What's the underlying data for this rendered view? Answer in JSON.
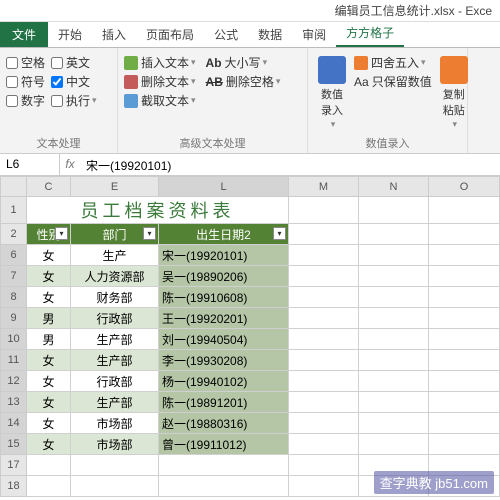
{
  "window": {
    "title": "编辑员工信息统计.xlsx - Exce"
  },
  "tabs": {
    "file": "文件",
    "items": [
      "开始",
      "插入",
      "页面布局",
      "公式",
      "数据",
      "审阅",
      "方方格子"
    ],
    "active": 6
  },
  "ribbon": {
    "g1": {
      "label": "文本处理",
      "chk_space": "空格",
      "chk_en": "英文",
      "chk_sym": "符号",
      "chk_cn": "中文",
      "chk_num": "数字",
      "chk_exec": "执行"
    },
    "g2": {
      "label": "高级文本处理",
      "insert_text": "插入文本",
      "case": "大小写",
      "delete_text": "删除文本",
      "del_space": "删除空格",
      "crop_text": "截取文本"
    },
    "g3": {
      "label": "数值录入",
      "big_label": "数值录入",
      "round": "四舍五入",
      "keep_num": "只保留数值",
      "paste": "复制粘贴"
    }
  },
  "namebox": {
    "ref": "L6",
    "fx": "fx",
    "formula": "宋一(19920101)"
  },
  "cols": [
    "",
    "C",
    "E",
    "L",
    "M",
    "N",
    "O"
  ],
  "sheet_title": "员工档案资料表",
  "headers": {
    "c": "性别",
    "e": "部门",
    "l": "出生日期2"
  },
  "rows": [
    {
      "n": "6",
      "c": "女",
      "e": "生产",
      "l": "宋一(19920101)"
    },
    {
      "n": "7",
      "c": "女",
      "e": "人力资源部",
      "l": "吴一(19890206)"
    },
    {
      "n": "8",
      "c": "女",
      "e": "财务部",
      "l": "陈一(19910608)"
    },
    {
      "n": "9",
      "c": "男",
      "e": "行政部",
      "l": "王一(19920201)"
    },
    {
      "n": "10",
      "c": "男",
      "e": "生产部",
      "l": "刘一(19940504)"
    },
    {
      "n": "11",
      "c": "女",
      "e": "生产部",
      "l": "李一(19930208)"
    },
    {
      "n": "12",
      "c": "女",
      "e": "行政部",
      "l": "杨一(19940102)"
    },
    {
      "n": "13",
      "c": "女",
      "e": "生产部",
      "l": "陈一(19891201)"
    },
    {
      "n": "14",
      "c": "女",
      "e": "市场部",
      "l": "赵一(19880316)"
    },
    {
      "n": "15",
      "c": "女",
      "e": "市场部",
      "l": "曾一(19911012)"
    }
  ],
  "empty_rows": [
    "17",
    "18"
  ],
  "watermark": "查字典教 jb51.com",
  "chart_data": {
    "type": "table",
    "title": "员工档案资料表",
    "columns": [
      "性别",
      "部门",
      "出生日期2"
    ],
    "data": [
      [
        "女",
        "生产",
        "宋一(19920101)"
      ],
      [
        "女",
        "人力资源部",
        "吴一(19890206)"
      ],
      [
        "女",
        "财务部",
        "陈一(19910608)"
      ],
      [
        "男",
        "行政部",
        "王一(19920201)"
      ],
      [
        "男",
        "生产部",
        "刘一(19940504)"
      ],
      [
        "女",
        "生产部",
        "李一(19930208)"
      ],
      [
        "女",
        "行政部",
        "杨一(19940102)"
      ],
      [
        "女",
        "生产部",
        "陈一(19891201)"
      ],
      [
        "女",
        "市场部",
        "赵一(19880316)"
      ],
      [
        "女",
        "市场部",
        "曾一(19911012)"
      ]
    ]
  }
}
